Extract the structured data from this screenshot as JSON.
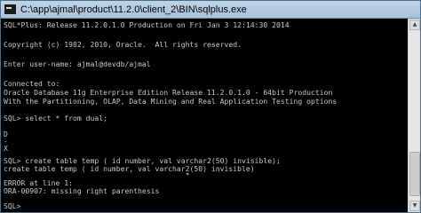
{
  "window": {
    "title": "C:\\app\\ajmal\\product\\11.2.0\\client_2\\BIN\\sqlplus.exe"
  },
  "console": {
    "lines": [
      "SQL*Plus: Release 11.2.0.1.0 Production on Fri Jan 3 12:14:30 2014",
      "",
      "Copyright (c) 1982, 2010, Oracle.  All rights reserved.",
      "",
      "Enter user-name: ajmal@devdb/ajmal",
      "",
      "Connected to:",
      "Oracle Database 11g Enterprise Edition Release 11.2.0.1.0 - 64bit Production",
      "With the Partitioning, OLAP, Data Mining and Real Application Testing options",
      "",
      "SQL> select * from dual;",
      "",
      "D",
      "-",
      "X",
      "",
      "SQL> create table temp ( id number, val varchar2(50) invisible);",
      "create table temp ( id number, val varchar2(50) invisible)",
      "                                          *",
      "ERROR at line 1:",
      "ORA-00907: missing right parenthesis",
      "",
      "",
      "SQL>"
    ]
  },
  "scrollbar": {
    "up_arrow_icon": "triangle-up",
    "down_arrow_icon": "triangle-down"
  }
}
